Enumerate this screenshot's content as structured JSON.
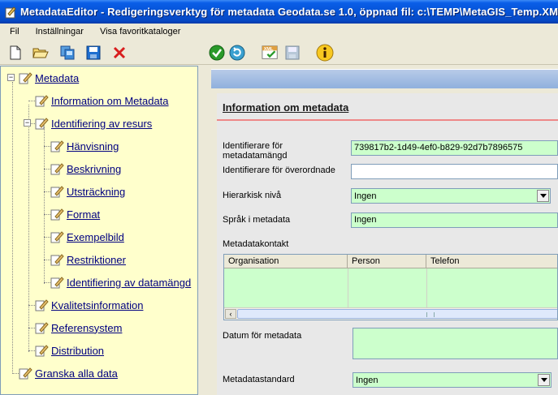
{
  "window": {
    "title": "MetadataEditor - Redigeringsverktyg för metadata Geodata.se 1.0, öppnad fil: c:\\TEMP\\MetaGIS_Temp.XML"
  },
  "menu": {
    "items": [
      "Fil",
      "Inställningar",
      "Visa favoritkataloger"
    ]
  },
  "toolbar": {
    "buttons": [
      "new-document-icon",
      "open-folder-icon",
      "copy-icon",
      "save-icon",
      "delete-icon",
      "validate-icon",
      "refresh-icon",
      "xml-check-icon",
      "save-disabled-icon",
      "info-icon"
    ]
  },
  "tree": {
    "root": "Metadata",
    "items": [
      {
        "label": "Information om Metadata"
      },
      {
        "label": "Identifiering av resurs"
      },
      {
        "label": "Hänvisning"
      },
      {
        "label": "Beskrivning"
      },
      {
        "label": "Utsträckning"
      },
      {
        "label": "Format"
      },
      {
        "label": "Exempelbild"
      },
      {
        "label": "Restriktioner"
      },
      {
        "label": "Identifiering av datamängd"
      },
      {
        "label": "Kvalitetsinformation"
      },
      {
        "label": "Referensystem"
      },
      {
        "label": "Distribution"
      }
    ],
    "bottom": "Granska alla data"
  },
  "form": {
    "section_title": "Information om metadata",
    "fields": {
      "identifier_label": "Identifierare för metadatamängd",
      "identifier_value": "739817b2-1d49-4ef0-b829-92d7b7896575",
      "parent_label": "Identifierare för överordnade",
      "parent_value": "",
      "hierarchy_label": "Hierarkisk nivå",
      "hierarchy_value": "Ingen",
      "language_label": "Språk i metadata",
      "language_value": "Ingen",
      "contact_label": "Metadatakontakt",
      "date_label": "Datum för metadata",
      "standard_label": "Metadatastandard",
      "standard_value": "Ingen"
    },
    "contact_columns": [
      "Organisation",
      "Person",
      "Telefon"
    ]
  },
  "colors": {
    "tree_bg": "#ffffcc",
    "field_bg": "#ccffcc",
    "title_blue": "#0653d6"
  }
}
